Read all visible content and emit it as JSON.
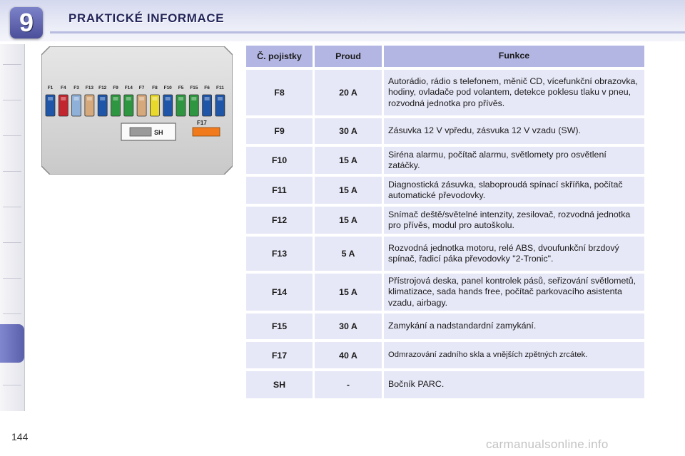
{
  "header": {
    "chapter_number": "9",
    "title": "PRAKTICKÉ INFORMACE"
  },
  "fuse_diagram": {
    "top_labels": [
      "F1",
      "F4",
      "F3",
      "F13",
      "F12",
      "F9",
      "F14",
      "F7",
      "F8",
      "F10",
      "F5",
      "F15",
      "F6",
      "F11"
    ],
    "fuse_colors": [
      "#1f56a8",
      "#c2262e",
      "#8fb0d8",
      "#d6a97c",
      "#1f56a8",
      "#2e9640",
      "#2e9640",
      "#d6a97c",
      "#e8d92c",
      "#1f56a8",
      "#2e9640",
      "#2e9640",
      "#1f56a8",
      "#1f56a8"
    ],
    "sh_label": "SH",
    "f17_label": "F17",
    "f17_color": "#f07a1c"
  },
  "table": {
    "headers": [
      "Č. pojistky",
      "Proud",
      "Funkce"
    ],
    "rows": [
      {
        "fuse": "F8",
        "amps": "20 A",
        "func": "Autorádio, rádio s telefonem, měnič CD, vícefunkční obrazovka, hodiny, ovladače pod volantem, detekce poklesu tlaku v pneu, rozvodná jednotka pro přívěs."
      },
      {
        "fuse": "F9",
        "amps": "30 A",
        "func": "Zásuvka 12 V vpředu, zásvuka 12 V vzadu (SW)."
      },
      {
        "fuse": "F10",
        "amps": "15 A",
        "func": "Siréna alarmu, počítač alarmu, světlomety pro osvětlení zatáčky."
      },
      {
        "fuse": "F11",
        "amps": "15 A",
        "func": "Diagnostická zásuvka, slaboproudá spínací skříňka, počítač automatické převodovky."
      },
      {
        "fuse": "F12",
        "amps": "15 A",
        "func": "Snímač deště/světelné intenzity, zesilovač, rozvodná jednotka pro přívěs, modul pro autoškolu."
      },
      {
        "fuse": "F13",
        "amps": "5 A",
        "func": "Rozvodná jednotka motoru, relé ABS, dvoufunkční brzdový spínač, řadicí páka převodovky \"2-Tronic\"."
      },
      {
        "fuse": "F14",
        "amps": "15 A",
        "func": "Přístrojová deska, panel kontrolek pásů, seřizování světlometů, klimatizace, sada hands free, počítač parkovacího asistenta vzadu, airbagy."
      },
      {
        "fuse": "F15",
        "amps": "30 A",
        "func": "Zamykání a nadstandardní zamykání."
      },
      {
        "fuse": "F17",
        "amps": "40 A",
        "func": "Odmrazování zadního skla a vnějších zpětných zrcátek."
      },
      {
        "fuse": "SH",
        "amps": "-",
        "func": "Bočník PARC."
      }
    ]
  },
  "page_number": "144",
  "watermark": "carmanualsonline.info"
}
